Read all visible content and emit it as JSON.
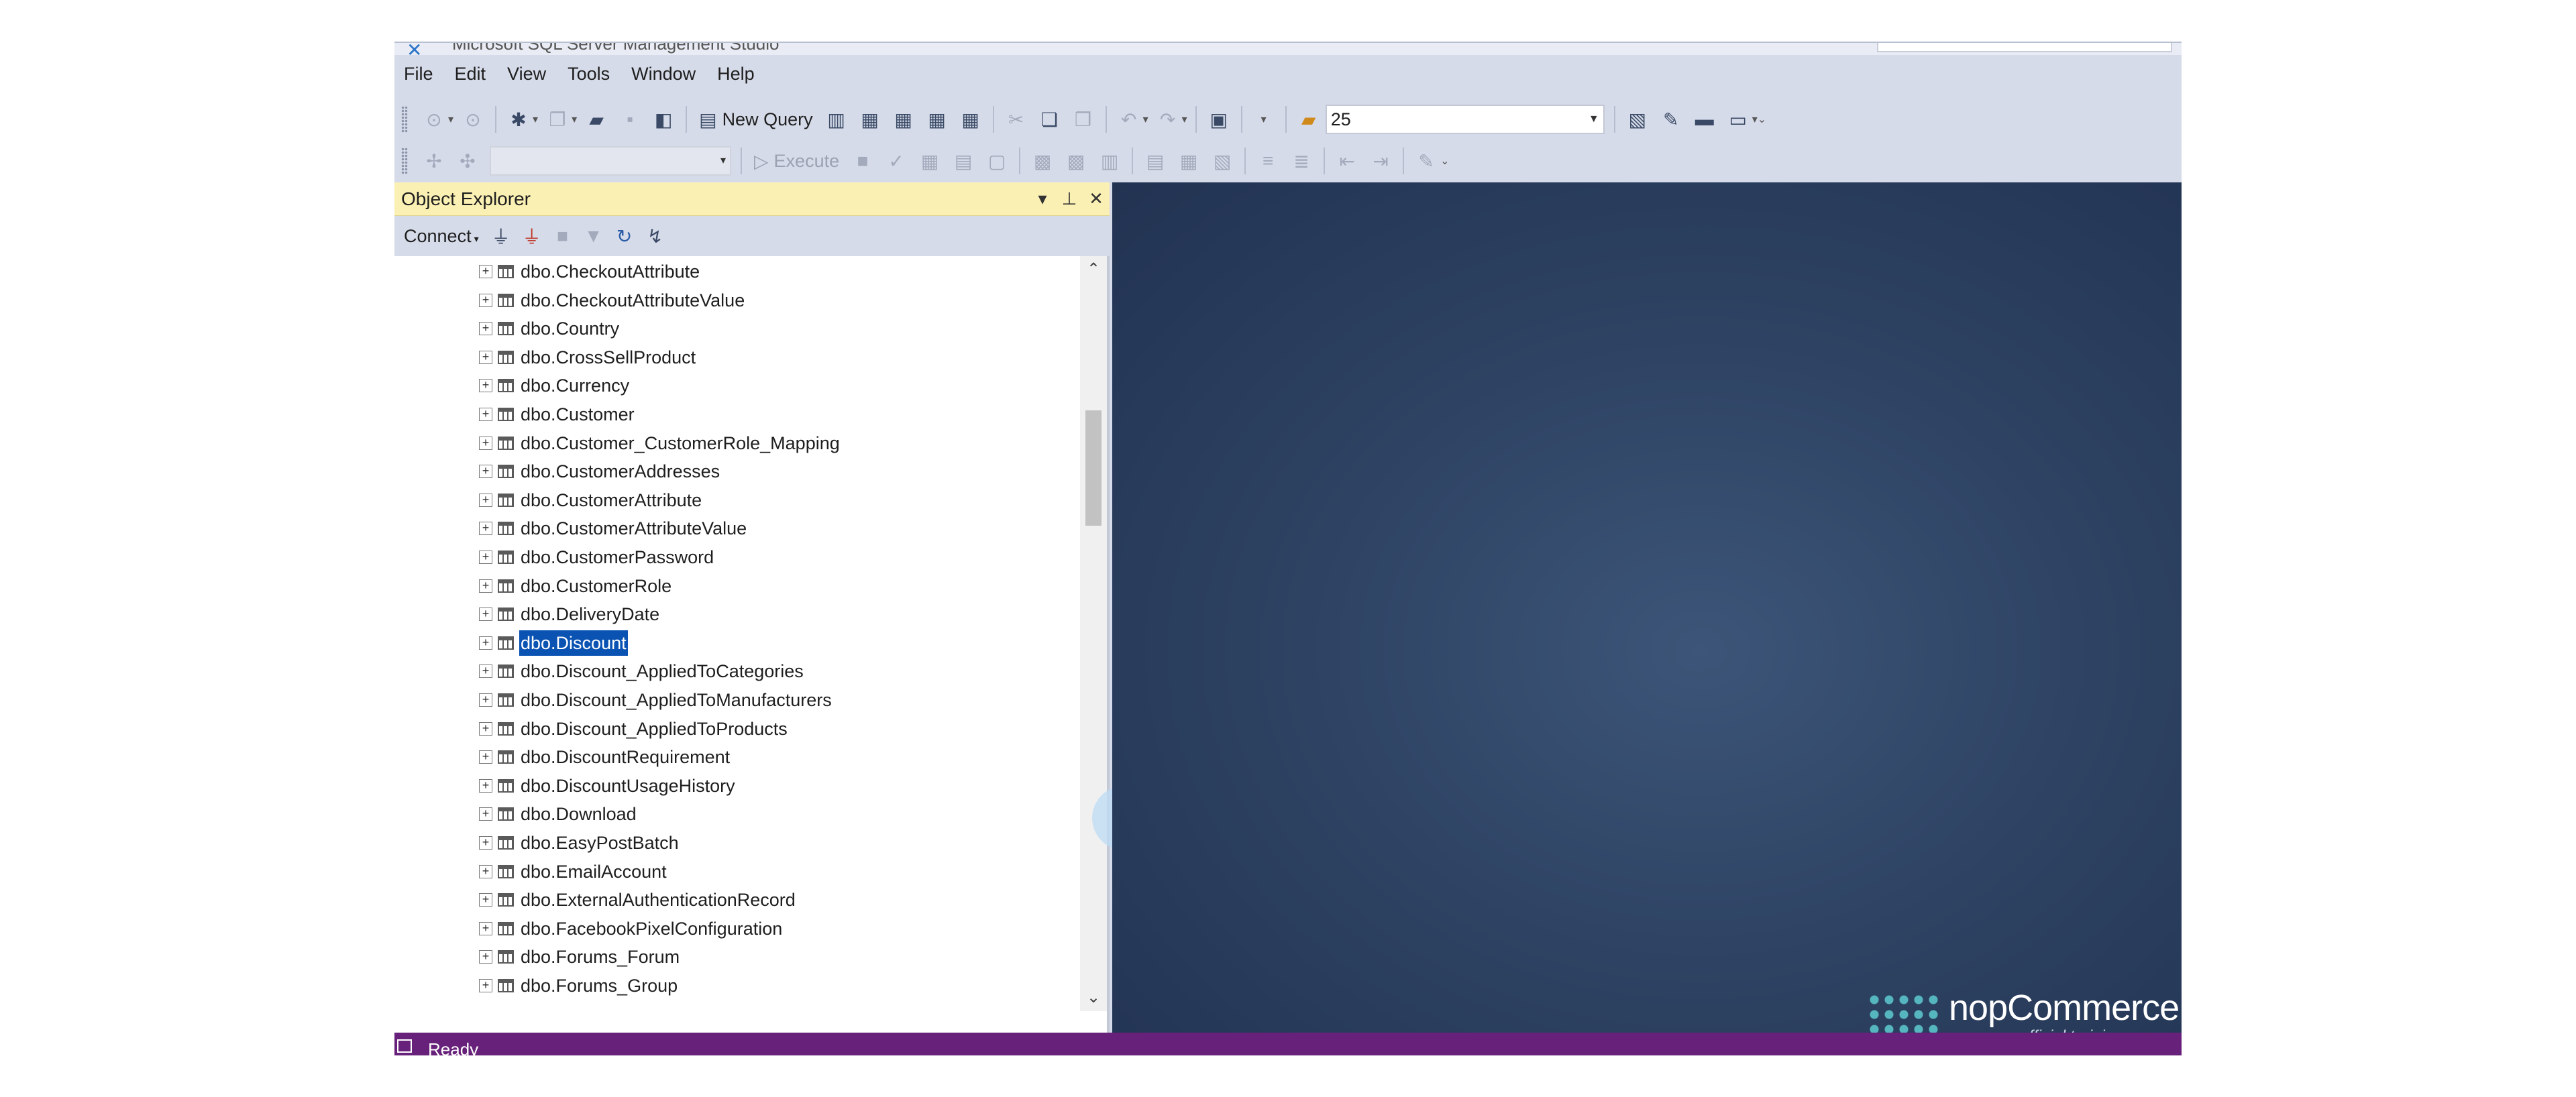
{
  "window": {
    "title": "Microsoft SQL Server Management Studio"
  },
  "menu": {
    "items": [
      "File",
      "Edit",
      "View",
      "Tools",
      "Window",
      "Help"
    ]
  },
  "toolbar1": {
    "new_query_label": "New Query",
    "combo_value": "25"
  },
  "toolbar2": {
    "execute_label": "Execute",
    "database_combo_value": ""
  },
  "object_explorer": {
    "title": "Object Explorer",
    "connect_label": "Connect",
    "items": [
      "dbo.CheckoutAttribute",
      "dbo.CheckoutAttributeValue",
      "dbo.Country",
      "dbo.CrossSellProduct",
      "dbo.Currency",
      "dbo.Customer",
      "dbo.Customer_CustomerRole_Mapping",
      "dbo.CustomerAddresses",
      "dbo.CustomerAttribute",
      "dbo.CustomerAttributeValue",
      "dbo.CustomerPassword",
      "dbo.CustomerRole",
      "dbo.DeliveryDate",
      "dbo.Discount",
      "dbo.Discount_AppliedToCategories",
      "dbo.Discount_AppliedToManufacturers",
      "dbo.Discount_AppliedToProducts",
      "dbo.DiscountRequirement",
      "dbo.DiscountUsageHistory",
      "dbo.Download",
      "dbo.EasyPostBatch",
      "dbo.EmailAccount",
      "dbo.ExternalAuthenticationRecord",
      "dbo.FacebookPixelConfiguration",
      "dbo.Forums_Forum",
      "dbo.Forums_Group"
    ],
    "selected_item": "dbo.Discount"
  },
  "watermark": {
    "brand": "nopCommerce",
    "subtitle": "official training course"
  },
  "status": {
    "text": "Ready"
  },
  "colors": {
    "statusbar": "#68217a",
    "selection": "#0a53b3",
    "panel_header": "#fbf0b4",
    "chrome": "#d6dbe9"
  }
}
